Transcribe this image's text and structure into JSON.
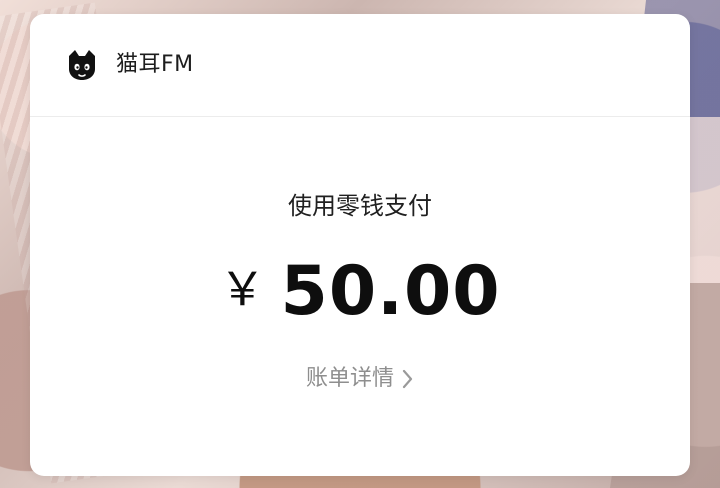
{
  "app": {
    "name": "猫耳FM"
  },
  "payment": {
    "method_label": "使用零钱支付",
    "currency_symbol": "￥",
    "amount": "50.00",
    "details_link_label": "账单详情"
  },
  "icons": {
    "brand": "cat-head-icon",
    "details_chevron": "chevron-right-icon"
  },
  "colors": {
    "card_background": "#FFFFFF",
    "primary_text": "#1D1D1D",
    "secondary_text": "#8E8E8E",
    "divider": "#ECECEC"
  }
}
